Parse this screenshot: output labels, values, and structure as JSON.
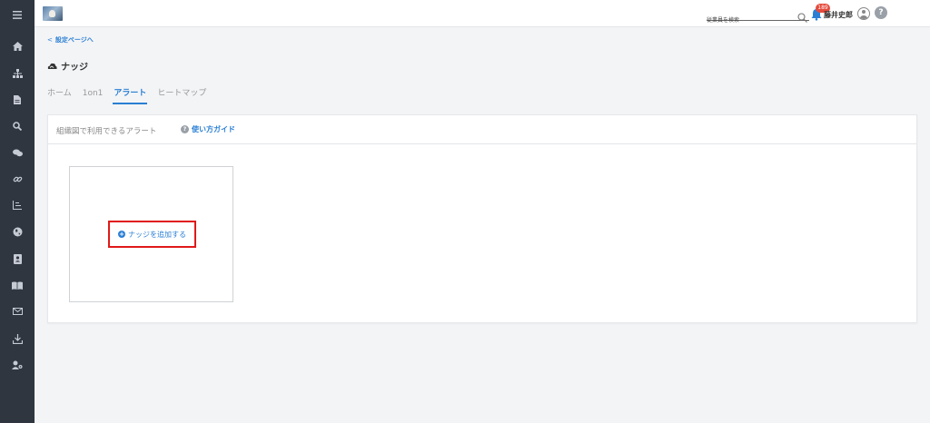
{
  "sidebar": {
    "bg_color": "#2f3640",
    "items": [
      {
        "icon": "menu-icon"
      },
      {
        "icon": "home-icon"
      },
      {
        "icon": "org-chart-icon"
      },
      {
        "icon": "document-icon"
      },
      {
        "icon": "search-icon"
      },
      {
        "icon": "chat-icon"
      },
      {
        "icon": "link-icon"
      },
      {
        "icon": "chart-icon"
      },
      {
        "icon": "globe-icon"
      },
      {
        "icon": "contacts-icon"
      },
      {
        "icon": "book-icon"
      },
      {
        "icon": "mail-icon"
      },
      {
        "icon": "download-icon"
      },
      {
        "icon": "user-settings-icon"
      }
    ]
  },
  "header": {
    "search_placeholder": "従業員を検索",
    "notification_count": "189",
    "user_name": "藤井史郎",
    "help_label": "?"
  },
  "breadcrumb": {
    "back_label": "設定ページへ"
  },
  "page": {
    "title": "ナッジ"
  },
  "tabs": [
    {
      "label": "ホーム",
      "active": false
    },
    {
      "label": "1on1",
      "active": false
    },
    {
      "label": "アラート",
      "active": true
    },
    {
      "label": "ヒートマップ",
      "active": false
    }
  ],
  "card": {
    "title": "組織図で利用できるアラート",
    "guide_label": "使い方ガイド",
    "add_button_label": "ナッジを追加する"
  },
  "colors": {
    "accent": "#2a7fd4",
    "badge": "#e54b3c",
    "highlight": "#e01919"
  }
}
